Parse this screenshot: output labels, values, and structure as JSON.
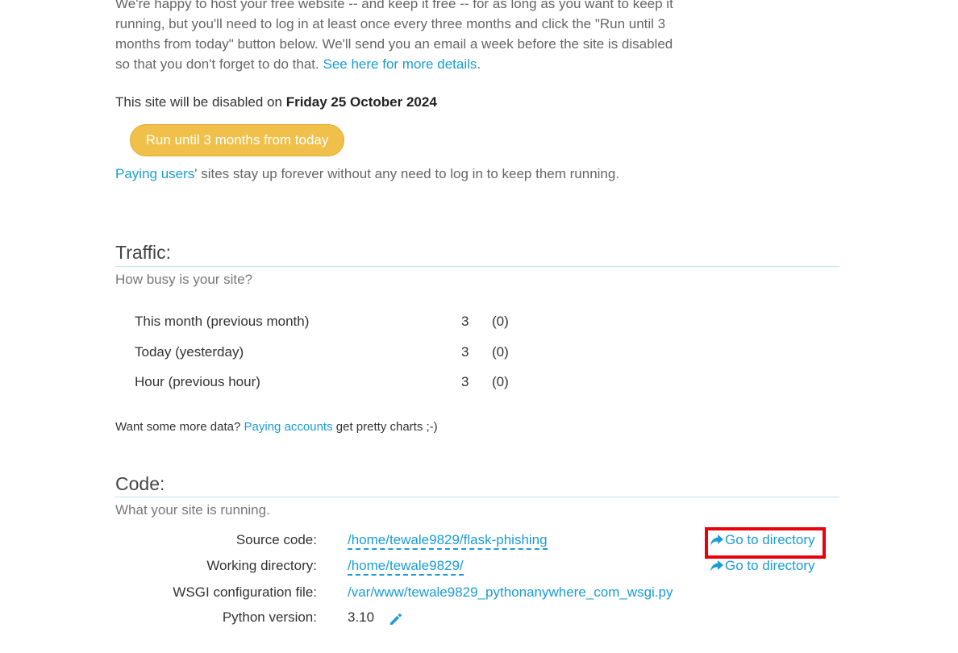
{
  "intro": {
    "text": "We're happy to host your free website -- and keep it free -- for as long as you want to keep it running, but you'll need to log in at least once every three months and click the \"Run until 3 months from today\" button below. We'll send you an email a week before the site is disabled so that you don't forget to do that.",
    "details_link": "See here for more details",
    "trailing": "."
  },
  "disable": {
    "prefix": "This site will be disabled on",
    "date": "Friday 25 October 2024"
  },
  "run_button_label": "Run until 3 months from today",
  "paying_note": {
    "link": "Paying users",
    "text": "' sites stay up forever without any need to log in to keep them running."
  },
  "traffic": {
    "title": "Traffic:",
    "subtitle": "How busy is your site?",
    "rows": [
      {
        "label": "This month (previous month)",
        "count": "3",
        "previous": "(0)"
      },
      {
        "label": "Today (yesterday)",
        "count": "3",
        "previous": "(0)"
      },
      {
        "label": "Hour (previous hour)",
        "count": "3",
        "previous": "(0)"
      }
    ],
    "more_prefix": "Want some more data?",
    "more_link": "Paying accounts",
    "more_suffix": "get pretty charts ;-)"
  },
  "code": {
    "title": "Code:",
    "subtitle": "What your site is running.",
    "source_label": "Source code:",
    "source_value": "/home/tewale9829/flask-phishing",
    "working_label": "Working directory:",
    "working_value": "/home/tewale9829/",
    "wsgi_label": "WSGI configuration file:",
    "wsgi_value": "/var/www/tewale9829_pythonanywhere_com_wsgi.py",
    "python_label": "Python version:",
    "python_value": "3.10",
    "goto_label": "Go to directory"
  },
  "colors": {
    "link": "#1a9cd6",
    "button": "#f0c04a",
    "highlight": "#e8000b",
    "rule": "#bfe2ec"
  },
  "icons": {
    "goto": "share-arrow-icon",
    "edit": "pencil-icon"
  }
}
